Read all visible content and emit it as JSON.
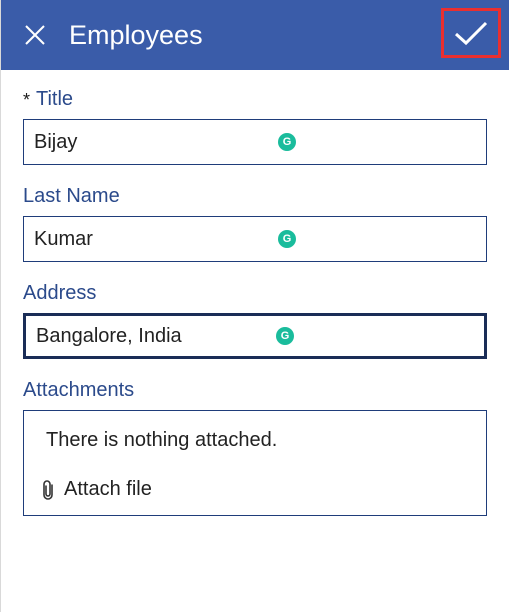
{
  "header": {
    "title": "Employees"
  },
  "fields": {
    "title": {
      "label": "Title",
      "value": "Bijay",
      "required": true
    },
    "lastName": {
      "label": "Last Name",
      "value": "Kumar",
      "required": false
    },
    "address": {
      "label": "Address",
      "value": "Bangalore, India",
      "required": false
    }
  },
  "attachments": {
    "label": "Attachments",
    "emptyText": "There is nothing attached.",
    "actionLabel": "Attach file"
  }
}
